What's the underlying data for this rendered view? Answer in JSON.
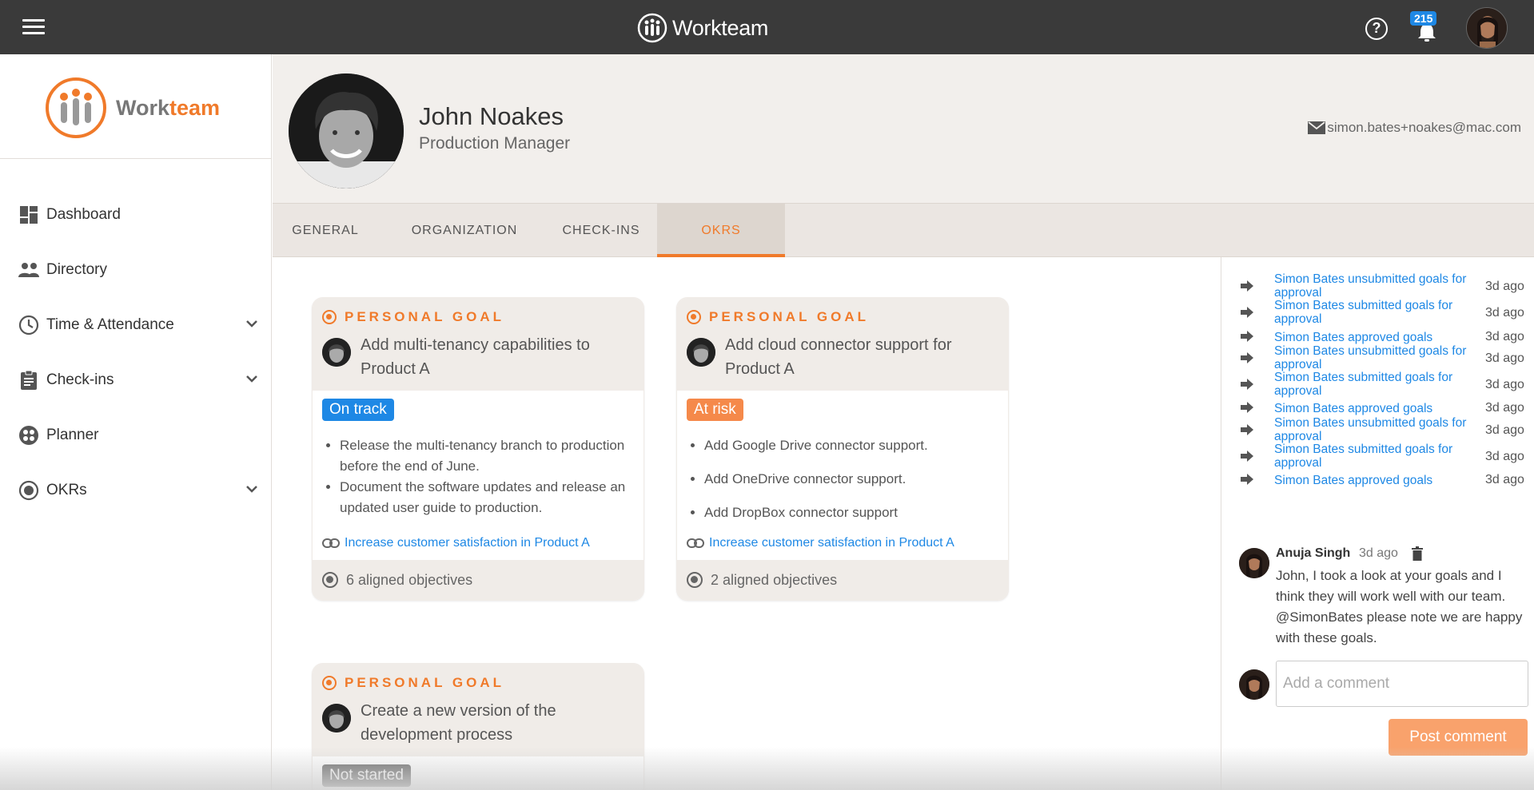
{
  "app": {
    "brand": "Workteam",
    "notification_count": "215"
  },
  "sidebar": {
    "logo": {
      "part1": "Work",
      "part2": "team"
    },
    "items": [
      {
        "label": "Dashboard",
        "icon": "dashboard-icon",
        "has_chevron": false
      },
      {
        "label": "Directory",
        "icon": "people-icon",
        "has_chevron": false
      },
      {
        "label": "Time & Attendance",
        "icon": "clock-icon",
        "has_chevron": true
      },
      {
        "label": "Check-ins",
        "icon": "clipboard-icon",
        "has_chevron": true
      },
      {
        "label": "Planner",
        "icon": "planner-icon",
        "has_chevron": false
      },
      {
        "label": "OKRs",
        "icon": "target-icon",
        "has_chevron": true
      }
    ]
  },
  "profile": {
    "name": "John Noakes",
    "title": "Production Manager",
    "email": "simon.bates+noakes@mac.com"
  },
  "tabs": [
    {
      "label": "GENERAL",
      "active": false
    },
    {
      "label": "ORGANIZATION",
      "active": false
    },
    {
      "label": "CHECK-INS",
      "active": false
    },
    {
      "label": "OKRS",
      "active": true
    }
  ],
  "goals": [
    {
      "type_label": "PERSONAL GOAL",
      "title": "Add multi-tenancy capabilities to Product A",
      "status": "On track",
      "key_results": [
        "Release the multi-tenancy branch to production before the end of June.",
        "Document the software updates and release an updated user guide to production."
      ],
      "link": "Increase customer satisfaction in Product A",
      "aligned": "6 aligned objectives"
    },
    {
      "type_label": "PERSONAL GOAL",
      "title": "Add cloud connector support for Product A",
      "status": "At risk",
      "key_results": [
        "Add Google Drive connector support.",
        "Add OneDrive connector support.",
        "Add DropBox connector support"
      ],
      "link": "Increase customer satisfaction in Product A",
      "aligned": "2 aligned objectives"
    },
    {
      "type_label": "PERSONAL GOAL",
      "title": "Create a new version of the development process",
      "status": "Not started"
    }
  ],
  "activity": [
    {
      "text": "Simon Bates unsubmitted goals for approval",
      "time": "3d ago"
    },
    {
      "text": "Simon Bates submitted goals for approval",
      "time": "3d ago"
    },
    {
      "text": "Simon Bates approved goals",
      "time": "3d ago"
    },
    {
      "text": "Simon Bates unsubmitted goals for approval",
      "time": "3d ago"
    },
    {
      "text": "Simon Bates submitted goals for approval",
      "time": "3d ago"
    },
    {
      "text": "Simon Bates approved goals",
      "time": "3d ago"
    },
    {
      "text": "Simon Bates unsubmitted goals for approval",
      "time": "3d ago"
    },
    {
      "text": "Simon Bates submitted goals for approval",
      "time": "3d ago"
    },
    {
      "text": "Simon Bates approved goals",
      "time": "3d ago"
    }
  ],
  "comment": {
    "author": "Anuja Singh",
    "time": "3d ago",
    "text": "John, I took a look at your goals and I think they will work well with our team.  @SimonBates please note we are happy with these goals."
  },
  "comment_input": {
    "placeholder": "Add a comment",
    "value": ""
  },
  "post_button": "Post comment",
  "colors": {
    "accent": "#f07a2a",
    "link": "#1e88e5",
    "on_track": "#1e88e5",
    "at_risk": "#f5894a",
    "not_started": "#666666"
  }
}
